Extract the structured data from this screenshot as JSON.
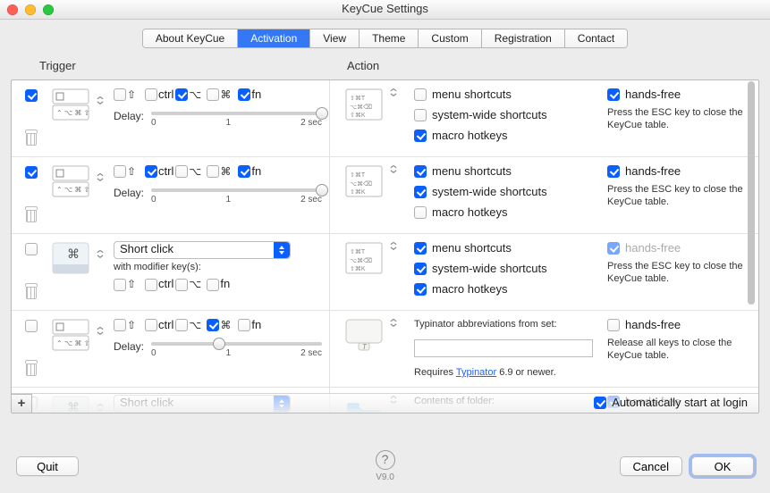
{
  "window": {
    "title": "KeyCue Settings"
  },
  "tabs": [
    {
      "label": "About KeyCue",
      "active": false
    },
    {
      "label": "Activation",
      "active": true
    },
    {
      "label": "View",
      "active": false
    },
    {
      "label": "Theme",
      "active": false
    },
    {
      "label": "Custom",
      "active": false
    },
    {
      "label": "Registration",
      "active": false
    },
    {
      "label": "Contact",
      "active": false
    }
  ],
  "headers": {
    "trigger": "Trigger",
    "action": "Action"
  },
  "modifier_labels": {
    "shift": "⇧",
    "ctrl": "ctrl",
    "option": "⌥",
    "command": "⌘",
    "fn": "fn"
  },
  "delay_label": "Delay:",
  "delay_ticks": [
    "0",
    "1",
    "2 sec"
  ],
  "dropdown": {
    "short_click": "Short click",
    "with_modifiers": "with modifier key(s):"
  },
  "action_opts": {
    "menu": "menu shortcuts",
    "system": "system-wide shortcuts",
    "macro": "macro hotkeys"
  },
  "handsfree": {
    "label": "hands-free",
    "desc_esc": "Press the ESC key to close the KeyCue table.",
    "desc_release": "Release all keys to close the KeyCue table."
  },
  "typinator": {
    "caption": "Typinator abbreviations from set:",
    "requires_pre": "Requires ",
    "requires_link": "Typinator",
    "requires_post": " 6.9 or newer."
  },
  "folder": {
    "caption": "Contents of folder:"
  },
  "rows": [
    {
      "enabled": true,
      "trigger": {
        "mode": "modifier_hold",
        "mods": {
          "shift": false,
          "ctrl": false,
          "option": true,
          "command": false,
          "fn": true
        },
        "delay_frac": 1.0
      },
      "action": {
        "kind": "keycue",
        "menu": false,
        "system": false,
        "macro": true,
        "handsfree": true,
        "handsfree_enabled": true,
        "desc": "esc"
      }
    },
    {
      "enabled": true,
      "trigger": {
        "mode": "modifier_hold",
        "mods": {
          "shift": false,
          "ctrl": true,
          "option": false,
          "command": false,
          "fn": true
        },
        "delay_frac": 1.0
      },
      "action": {
        "kind": "keycue",
        "menu": true,
        "system": true,
        "macro": false,
        "handsfree": true,
        "handsfree_enabled": true,
        "desc": "esc"
      }
    },
    {
      "enabled": false,
      "trigger": {
        "mode": "short_click_mods",
        "mods": {
          "shift": false,
          "ctrl": false,
          "option": false,
          "command": false,
          "fn": false
        }
      },
      "action": {
        "kind": "keycue",
        "menu": true,
        "system": true,
        "macro": true,
        "handsfree": true,
        "handsfree_enabled": false,
        "desc": "esc"
      }
    },
    {
      "enabled": false,
      "trigger": {
        "mode": "modifier_hold",
        "mods": {
          "shift": false,
          "ctrl": false,
          "option": false,
          "command": true,
          "fn": false
        },
        "delay_frac": 0.4
      },
      "action": {
        "kind": "typinator",
        "handsfree": false,
        "handsfree_enabled": true,
        "desc": "release"
      }
    },
    {
      "enabled": false,
      "trigger": {
        "mode": "short_click_only"
      },
      "action": {
        "kind": "folder",
        "handsfree": true,
        "handsfree_enabled": true,
        "desc": "esc"
      }
    }
  ],
  "panel_footer": {
    "auto_start": "Automatically start at login",
    "auto_start_checked": true
  },
  "footer": {
    "quit": "Quit",
    "cancel": "Cancel",
    "ok": "OK",
    "version": "V9.0"
  }
}
